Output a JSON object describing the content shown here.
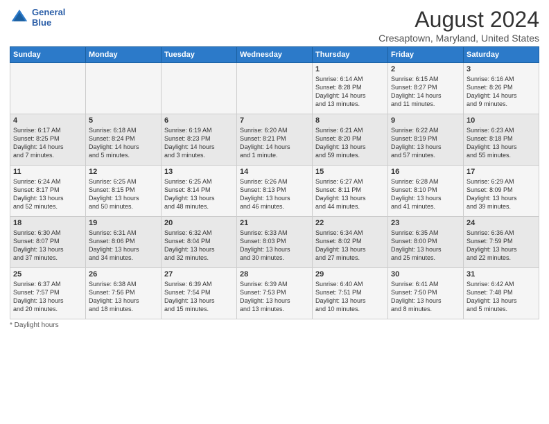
{
  "header": {
    "logo_line1": "General",
    "logo_line2": "Blue",
    "title": "August 2024",
    "subtitle": "Cresaptown, Maryland, United States"
  },
  "days_of_week": [
    "Sunday",
    "Monday",
    "Tuesday",
    "Wednesday",
    "Thursday",
    "Friday",
    "Saturday"
  ],
  "footer": {
    "daylight_label": "Daylight hours"
  },
  "weeks": [
    [
      {
        "day": "",
        "info": ""
      },
      {
        "day": "",
        "info": ""
      },
      {
        "day": "",
        "info": ""
      },
      {
        "day": "",
        "info": ""
      },
      {
        "day": "1",
        "info": "Sunrise: 6:14 AM\nSunset: 8:28 PM\nDaylight: 14 hours\nand 13 minutes."
      },
      {
        "day": "2",
        "info": "Sunrise: 6:15 AM\nSunset: 8:27 PM\nDaylight: 14 hours\nand 11 minutes."
      },
      {
        "day": "3",
        "info": "Sunrise: 6:16 AM\nSunset: 8:26 PM\nDaylight: 14 hours\nand 9 minutes."
      }
    ],
    [
      {
        "day": "4",
        "info": "Sunrise: 6:17 AM\nSunset: 8:25 PM\nDaylight: 14 hours\nand 7 minutes."
      },
      {
        "day": "5",
        "info": "Sunrise: 6:18 AM\nSunset: 8:24 PM\nDaylight: 14 hours\nand 5 minutes."
      },
      {
        "day": "6",
        "info": "Sunrise: 6:19 AM\nSunset: 8:23 PM\nDaylight: 14 hours\nand 3 minutes."
      },
      {
        "day": "7",
        "info": "Sunrise: 6:20 AM\nSunset: 8:21 PM\nDaylight: 14 hours\nand 1 minute."
      },
      {
        "day": "8",
        "info": "Sunrise: 6:21 AM\nSunset: 8:20 PM\nDaylight: 13 hours\nand 59 minutes."
      },
      {
        "day": "9",
        "info": "Sunrise: 6:22 AM\nSunset: 8:19 PM\nDaylight: 13 hours\nand 57 minutes."
      },
      {
        "day": "10",
        "info": "Sunrise: 6:23 AM\nSunset: 8:18 PM\nDaylight: 13 hours\nand 55 minutes."
      }
    ],
    [
      {
        "day": "11",
        "info": "Sunrise: 6:24 AM\nSunset: 8:17 PM\nDaylight: 13 hours\nand 52 minutes."
      },
      {
        "day": "12",
        "info": "Sunrise: 6:25 AM\nSunset: 8:15 PM\nDaylight: 13 hours\nand 50 minutes."
      },
      {
        "day": "13",
        "info": "Sunrise: 6:25 AM\nSunset: 8:14 PM\nDaylight: 13 hours\nand 48 minutes."
      },
      {
        "day": "14",
        "info": "Sunrise: 6:26 AM\nSunset: 8:13 PM\nDaylight: 13 hours\nand 46 minutes."
      },
      {
        "day": "15",
        "info": "Sunrise: 6:27 AM\nSunset: 8:11 PM\nDaylight: 13 hours\nand 44 minutes."
      },
      {
        "day": "16",
        "info": "Sunrise: 6:28 AM\nSunset: 8:10 PM\nDaylight: 13 hours\nand 41 minutes."
      },
      {
        "day": "17",
        "info": "Sunrise: 6:29 AM\nSunset: 8:09 PM\nDaylight: 13 hours\nand 39 minutes."
      }
    ],
    [
      {
        "day": "18",
        "info": "Sunrise: 6:30 AM\nSunset: 8:07 PM\nDaylight: 13 hours\nand 37 minutes."
      },
      {
        "day": "19",
        "info": "Sunrise: 6:31 AM\nSunset: 8:06 PM\nDaylight: 13 hours\nand 34 minutes."
      },
      {
        "day": "20",
        "info": "Sunrise: 6:32 AM\nSunset: 8:04 PM\nDaylight: 13 hours\nand 32 minutes."
      },
      {
        "day": "21",
        "info": "Sunrise: 6:33 AM\nSunset: 8:03 PM\nDaylight: 13 hours\nand 30 minutes."
      },
      {
        "day": "22",
        "info": "Sunrise: 6:34 AM\nSunset: 8:02 PM\nDaylight: 13 hours\nand 27 minutes."
      },
      {
        "day": "23",
        "info": "Sunrise: 6:35 AM\nSunset: 8:00 PM\nDaylight: 13 hours\nand 25 minutes."
      },
      {
        "day": "24",
        "info": "Sunrise: 6:36 AM\nSunset: 7:59 PM\nDaylight: 13 hours\nand 22 minutes."
      }
    ],
    [
      {
        "day": "25",
        "info": "Sunrise: 6:37 AM\nSunset: 7:57 PM\nDaylight: 13 hours\nand 20 minutes."
      },
      {
        "day": "26",
        "info": "Sunrise: 6:38 AM\nSunset: 7:56 PM\nDaylight: 13 hours\nand 18 minutes."
      },
      {
        "day": "27",
        "info": "Sunrise: 6:39 AM\nSunset: 7:54 PM\nDaylight: 13 hours\nand 15 minutes."
      },
      {
        "day": "28",
        "info": "Sunrise: 6:39 AM\nSunset: 7:53 PM\nDaylight: 13 hours\nand 13 minutes."
      },
      {
        "day": "29",
        "info": "Sunrise: 6:40 AM\nSunset: 7:51 PM\nDaylight: 13 hours\nand 10 minutes."
      },
      {
        "day": "30",
        "info": "Sunrise: 6:41 AM\nSunset: 7:50 PM\nDaylight: 13 hours\nand 8 minutes."
      },
      {
        "day": "31",
        "info": "Sunrise: 6:42 AM\nSunset: 7:48 PM\nDaylight: 13 hours\nand 5 minutes."
      }
    ]
  ]
}
